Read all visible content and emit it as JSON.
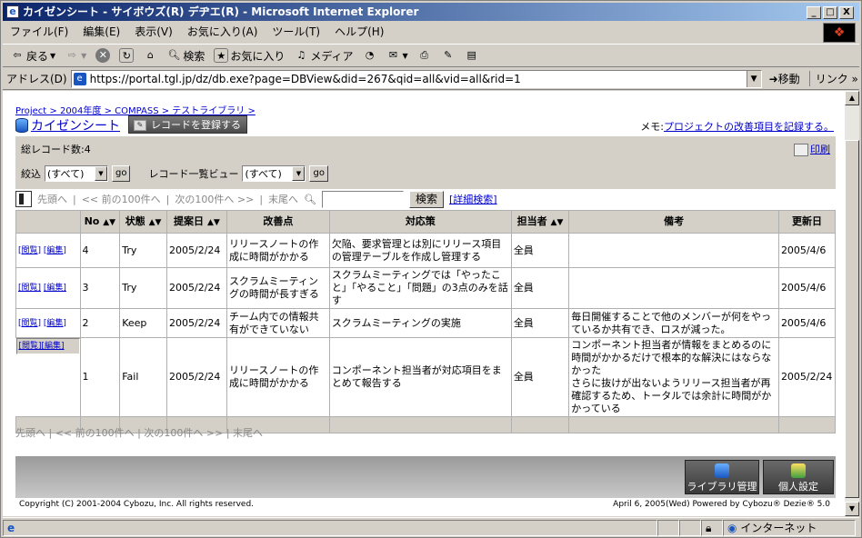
{
  "window": {
    "title": "カイゼンシート - サイボウズ(R) デヂエ(R) - Microsoft Internet Explorer",
    "controls": [
      "_",
      "□",
      "X"
    ]
  },
  "menu": [
    "ファイル(F)",
    "編集(E)",
    "表示(V)",
    "お気に入り(A)",
    "ツール(T)",
    "ヘルプ(H)"
  ],
  "toolbar": {
    "back": "戻る",
    "search": "検索",
    "favorites": "お気に入り",
    "media": "メディア"
  },
  "address": {
    "label": "アドレス(D)",
    "url": "https://portal.tgl.jp/dz/db.exe?page=DBView&did=267&qid=all&vid=all&rid=1",
    "go": "移動",
    "links": "リンク »"
  },
  "page": {
    "breadcrumb": "Project > 2004年度 > COMPASS > テストライブラリ >",
    "app_title": "カイゼンシート",
    "register_button": "レコードを登録する",
    "memo_label": "メモ:",
    "memo_link": "プロジェクトの改善項目を記録する。",
    "record_count": "総レコード数:4",
    "print": "印刷",
    "filter_label": "絞込",
    "filter_value": "(すべて)",
    "go": "go",
    "view_label": "レコード一覧ビュー",
    "view_value": "(すべて)",
    "nav": {
      "first": "先頭へ",
      "prev": "<< 前の100件へ",
      "next": "次の100件へ >>",
      "last": "末尾へ",
      "sep": "|",
      "search_button": "検索",
      "advanced_search": "[詳細検索]"
    },
    "columns": [
      "No",
      "状態",
      "提案日",
      "改善点",
      "対応策",
      "担当者",
      "備考",
      "更新日"
    ],
    "rows": [
      {
        "view": "[閲覧]",
        "edit": "[編集]",
        "no": "4",
        "status": "Try",
        "date": "2005/2/24",
        "issue": "リリースノートの作成に時間がかかる",
        "action": "欠陥、要求管理とは別にリリース項目の管理テーブルを作成し管理する",
        "owner": "全員",
        "note": "",
        "updated": "2005/4/6"
      },
      {
        "view": "[閲覧]",
        "edit": "[編集]",
        "no": "3",
        "status": "Try",
        "date": "2005/2/24",
        "issue": "スクラムミーティングの時間が長すぎる",
        "action": "スクラムミーティングでは「やったこと」「やること」「問題」の3点のみを話す",
        "owner": "全員",
        "note": "",
        "updated": "2005/4/6"
      },
      {
        "view": "[閲覧]",
        "edit": "[編集]",
        "no": "2",
        "status": "Keep",
        "date": "2005/2/24",
        "issue": "チーム内での情報共有ができていない",
        "action": "スクラムミーティングの実施",
        "owner": "全員",
        "note": "毎日開催することで他のメンバーが何をやっているか共有でき、ロスが減った。",
        "updated": "2005/4/6"
      },
      {
        "view": "[閲覧]",
        "edit": "[編集]",
        "no": "1",
        "status": "Fail",
        "date": "2005/2/24",
        "issue": "リリースノートの作成に時間がかかる",
        "action": "コンポーネント担当者が対応項目をまとめて報告する",
        "owner": "全員",
        "note": "コンポーネント担当者が情報をまとめるのに時間がかかるだけで根本的な解決にはならなかった\nさらに抜けが出ないようリリース担当者が再確認するため、トータルでは余計に時間がかかっている",
        "updated": "2005/2/24"
      }
    ],
    "library_button": "ライブラリ管理",
    "personal_button": "個人設定",
    "copyright": "Copyright (C) 2001-2004 Cybozu, Inc. All rights reserved.",
    "powered": "April 6, 2005(Wed)   Powered by Cybozu® Dezie® 5.0"
  },
  "status": {
    "zone": "インターネット"
  }
}
